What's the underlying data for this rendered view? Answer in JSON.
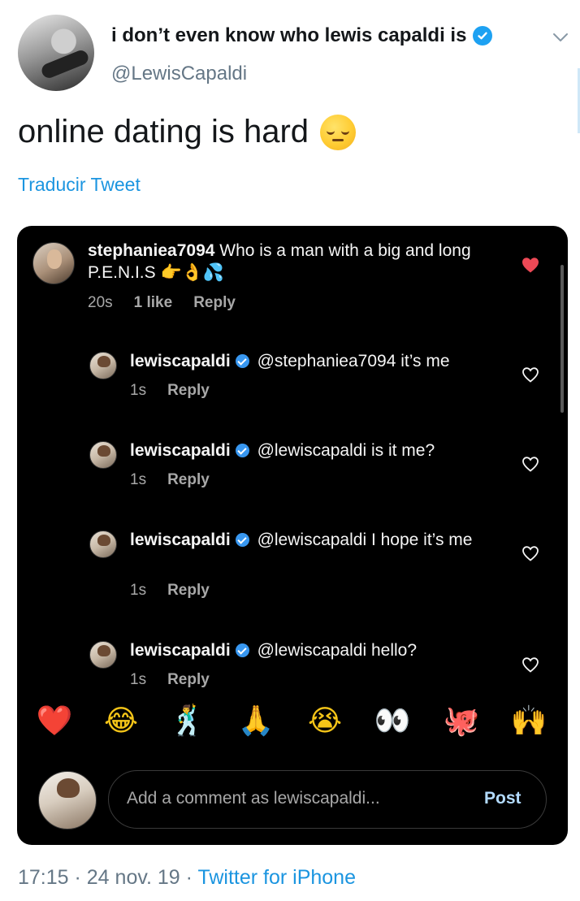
{
  "tweet": {
    "display_name": "i don’t even know who lewis capaldi is",
    "handle": "@LewisCapaldi",
    "text": "online dating is hard",
    "text_emoji": "pensive-face",
    "translate_label": "Traducir Tweet",
    "time": "17:15",
    "separator": " · ",
    "date": "24 nov. 19",
    "client": "Twitter for iPhone"
  },
  "screenshot": {
    "comments": [
      {
        "username": "stephaniea7094",
        "verified": false,
        "text": "Who is a man with a big and long P.E.N.I.S",
        "text_emojis": "👉👌💦",
        "time": "20s",
        "likes": "1 like",
        "reply_label": "Reply",
        "liked": true
      },
      {
        "username": "lewiscapaldi",
        "verified": true,
        "text": "@stephaniea7094 it’s me",
        "time": "1s",
        "reply_label": "Reply",
        "liked": false
      },
      {
        "username": "lewiscapaldi",
        "verified": true,
        "text": "@lewiscapaldi is it me?",
        "time": "1s",
        "reply_label": "Reply",
        "liked": false
      },
      {
        "username": "lewiscapaldi",
        "verified": true,
        "text": "@lewiscapaldi I hope it’s me",
        "time": "1s",
        "reply_label": "Reply",
        "liked": false
      },
      {
        "username": "lewiscapaldi",
        "verified": true,
        "text": "@lewiscapaldi hello?",
        "time": "1s",
        "reply_label": "Reply",
        "liked": false
      }
    ],
    "quick_emojis": [
      "❤️",
      "😂",
      "🕺",
      "🙏",
      "😭",
      "👀",
      "🐙",
      "🙌"
    ],
    "comment_placeholder": "Add a comment as lewiscapaldi...",
    "post_label": "Post"
  },
  "colors": {
    "twitter_blue": "#1DA1F2",
    "link_blue": "#1B95E0",
    "muted_gray": "#657786",
    "ig_background": "#000000",
    "ig_like_red": "#ED4956",
    "ig_post_blue": "#B3DBFF"
  }
}
